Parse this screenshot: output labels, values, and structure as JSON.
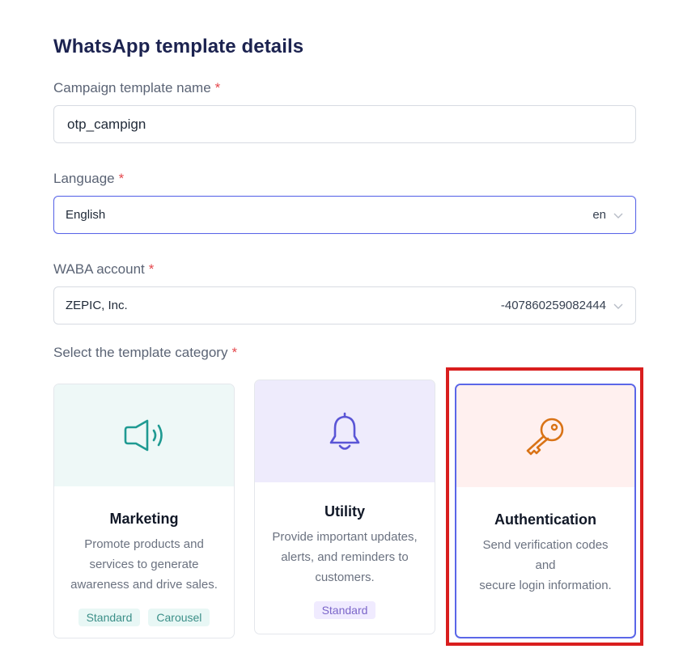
{
  "page": {
    "title": "WhatsApp template details"
  },
  "fields": {
    "campaign_name": {
      "label": "Campaign template name",
      "required_mark": "*",
      "value": "otp_campign"
    },
    "language": {
      "label": "Language",
      "required_mark": "*",
      "value": "English",
      "code": "en"
    },
    "waba": {
      "label": "WABA account",
      "required_mark": "*",
      "value": "ZEPIC, Inc.",
      "account_id": "-407860259082444"
    },
    "category": {
      "label": "Select the template category",
      "required_mark": "*"
    }
  },
  "categories": [
    {
      "name": "Marketing",
      "description": "Promote products and services to generate awareness and drive sales.",
      "desc_lines": [
        "Promote products and",
        "services to generate",
        "awareness and drive sales."
      ],
      "tags": [
        "Standard",
        "Carousel"
      ],
      "icon": "megaphone-icon",
      "bg": "#eef8f7",
      "icon_color": "#1f9a92"
    },
    {
      "name": "Utility",
      "description": "Provide important updates, alerts, and reminders to customers.",
      "desc_lines": [
        "Provide important updates,",
        "alerts, and reminders to",
        "customers."
      ],
      "tags": [
        "Standard"
      ],
      "icon": "bell-icon",
      "bg": "#eeebfc",
      "icon_color": "#5a55d6"
    },
    {
      "name": "Authentication",
      "description": "Send verification codes and secure login information.",
      "desc_lines": [
        "Send verification codes and",
        "secure login information."
      ],
      "tags": [],
      "icon": "key-icon",
      "bg": "#fff0ef",
      "icon_color": "#d97316",
      "selected": true
    }
  ],
  "colors": {
    "accent": "#5b67e8",
    "highlight": "#d91e1e",
    "title": "#1c2350"
  }
}
